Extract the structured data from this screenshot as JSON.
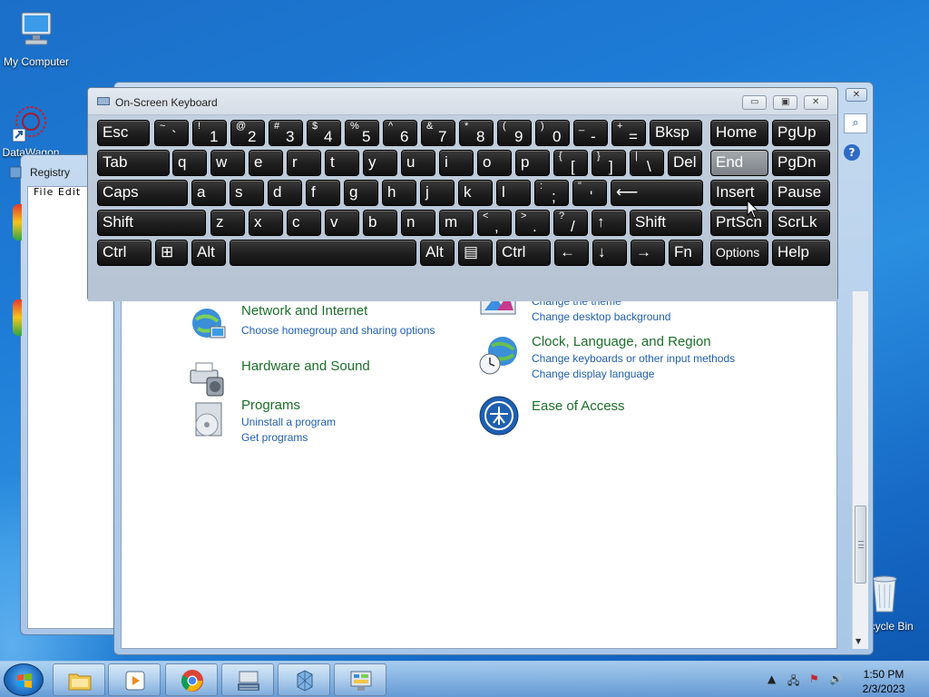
{
  "desktop": {
    "icons": [
      {
        "label": "My Computer"
      },
      {
        "label": "DataWagon"
      },
      {
        "label": "Recycle Bin"
      }
    ]
  },
  "registry_window": {
    "title": "Registry",
    "menu": "File  Edit"
  },
  "control_panel": {
    "categories": [
      {
        "title": "Network and Internet",
        "links": [
          "Choose homegroup and sharing options"
        ]
      },
      {
        "title": "Hardware and Sound",
        "links": []
      },
      {
        "title": "Programs",
        "links": [
          "Uninstall a program",
          "Get programs"
        ]
      },
      {
        "title": "",
        "links": [
          "Change the theme",
          "Change desktop background"
        ]
      },
      {
        "title": "Clock, Language, and Region",
        "links": [
          "Change keyboards or other input methods",
          "Change display language"
        ]
      },
      {
        "title": "Ease of Access",
        "links": []
      }
    ]
  },
  "osk": {
    "title": "On-Screen Keyboard",
    "rows": [
      [
        {
          "k": "Esc"
        },
        {
          "u": "~",
          "l": "`"
        },
        {
          "u": "!",
          "l": "1"
        },
        {
          "u": "@",
          "l": "2"
        },
        {
          "u": "#",
          "l": "3"
        },
        {
          "u": "$",
          "l": "4"
        },
        {
          "u": "%",
          "l": "5"
        },
        {
          "u": "^",
          "l": "6"
        },
        {
          "u": "&",
          "l": "7"
        },
        {
          "u": "*",
          "l": "8"
        },
        {
          "u": "(",
          "l": "9"
        },
        {
          "u": ")",
          "l": "0"
        },
        {
          "u": "_",
          "l": "-"
        },
        {
          "u": "+",
          "l": "="
        },
        {
          "k": "Bksp"
        },
        {
          "k": "Home"
        },
        {
          "k": "PgUp"
        }
      ],
      [
        {
          "k": "Tab"
        },
        {
          "k": "q"
        },
        {
          "k": "w"
        },
        {
          "k": "e"
        },
        {
          "k": "r"
        },
        {
          "k": "t"
        },
        {
          "k": "y"
        },
        {
          "k": "u"
        },
        {
          "k": "i"
        },
        {
          "k": "o"
        },
        {
          "k": "p"
        },
        {
          "u": "{",
          "l": "["
        },
        {
          "u": "}",
          "l": "]"
        },
        {
          "u": "|",
          "l": "\\"
        },
        {
          "k": "Del"
        },
        {
          "k": "End"
        },
        {
          "k": "PgDn"
        }
      ],
      [
        {
          "k": "Caps"
        },
        {
          "k": "a"
        },
        {
          "k": "s"
        },
        {
          "k": "d"
        },
        {
          "k": "f"
        },
        {
          "k": "g"
        },
        {
          "k": "h"
        },
        {
          "k": "j"
        },
        {
          "k": "k"
        },
        {
          "k": "l"
        },
        {
          "u": ":",
          "l": ";"
        },
        {
          "u": "\"",
          "l": "'"
        },
        {
          "k": "⟵"
        },
        {
          "k": "Insert"
        },
        {
          "k": "Pause"
        }
      ],
      [
        {
          "k": "Shift"
        },
        {
          "k": "z"
        },
        {
          "k": "x"
        },
        {
          "k": "c"
        },
        {
          "k": "v"
        },
        {
          "k": "b"
        },
        {
          "k": "n"
        },
        {
          "k": "m"
        },
        {
          "u": "<",
          "l": ","
        },
        {
          "u": ">",
          "l": "."
        },
        {
          "u": "?",
          "l": "/"
        },
        {
          "k": "↑"
        },
        {
          "k": "Shift"
        },
        {
          "k": "PrtScn"
        },
        {
          "k": "ScrLk"
        }
      ],
      [
        {
          "k": "Ctrl"
        },
        {
          "k": "⊞"
        },
        {
          "k": "Alt"
        },
        {
          "k": ""
        },
        {
          "k": "Alt"
        },
        {
          "k": "▤"
        },
        {
          "k": "Ctrl"
        },
        {
          "k": "←"
        },
        {
          "k": "↓"
        },
        {
          "k": "→"
        },
        {
          "k": "Fn"
        },
        {
          "k": "Options"
        },
        {
          "k": "Help"
        }
      ]
    ]
  },
  "taskbar": {
    "time": "1:50 PM",
    "date": "2/3/2023"
  },
  "colors": {
    "category_title": "#1c6f2a",
    "category_link": "#1f5fb0",
    "highlighted_key": "#8d9297"
  }
}
